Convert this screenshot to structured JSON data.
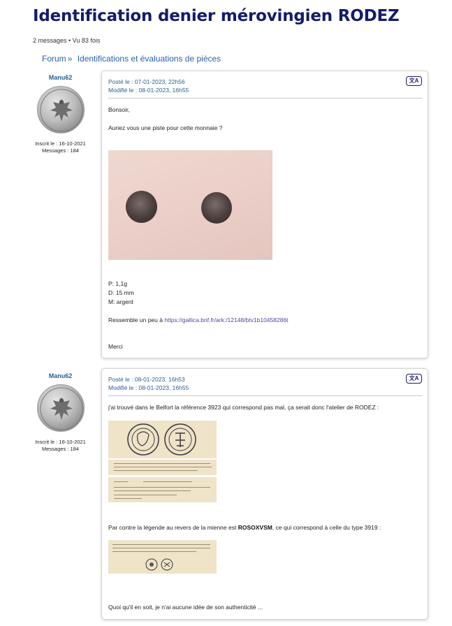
{
  "page": {
    "title": "Identification denier mérovingien RODEZ",
    "meta": "2 messages • Vu 83 fois"
  },
  "breadcrumb": {
    "forum": "Forum",
    "separator": "»",
    "section": "Identifications et évaluations de pièces"
  },
  "posts": [
    {
      "author": "Manu62",
      "inscrit": "Inscrit le : 16-10-2021",
      "messages": "Messages : 184",
      "posted": "Posté le : 07-01-2023, 22h56",
      "modified": "Modifié le : 08-01-2023, 16h55",
      "translate_label": "文A",
      "lines": {
        "greeting": "Bonsoir,",
        "question": "Auriez vous une piste pour cette monnaie ?",
        "weight": "P: 1,1g",
        "diameter": "D: 15 mm",
        "metal": "M: argent",
        "resemble_prefix": "Ressemble un peu à ",
        "resemble_link": "https://gallica.bnf.fr/ark:/12148/btv1b10458286t",
        "thanks": "Merci"
      }
    },
    {
      "author": "Manu62",
      "inscrit": "Inscrit le : 16-10-2021",
      "messages": "Messages : 184",
      "posted": "Posté le : 08-01-2023, 16h53",
      "modified": "Modifié le : 08-01-2023, 16h55",
      "translate_label": "文A",
      "lines": {
        "found": "j'ai trouvé dans le Belfort la référence 3923 qui correspond pas mal, ça serait donc l'atelier de RODEZ :",
        "legend_prefix": "Par contre la légende au revers de la mienne est ",
        "legend_bold": "ROSOXVSM",
        "legend_suffix": ", ce qui correspond à celle du type 3919 :",
        "closing": "Quoi qu'il en soit, je n'ai aucune idée de son authenticité ..."
      }
    }
  ],
  "icons": [
    "translate-icon",
    "avatar-eagle-coin-icon"
  ]
}
